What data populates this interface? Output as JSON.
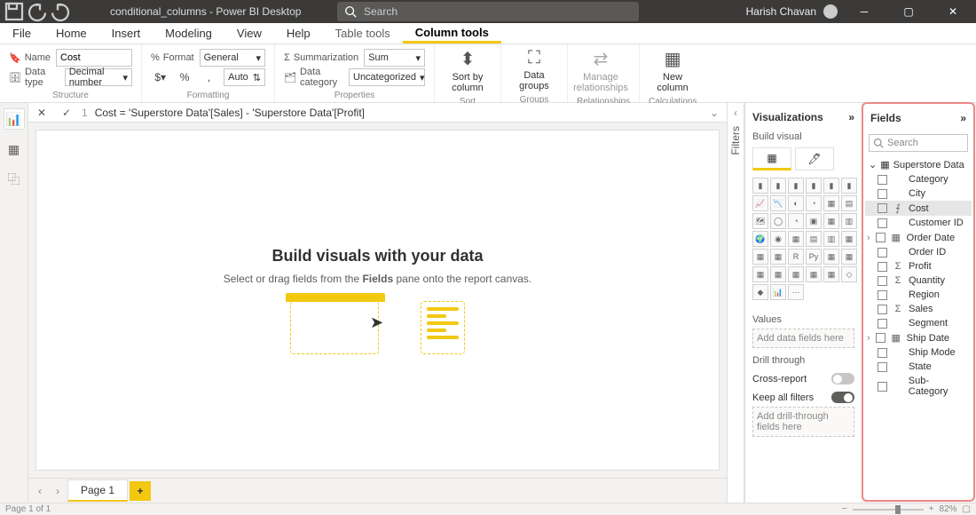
{
  "title": "conditional_columns - Power BI Desktop",
  "search_placeholder": "Search",
  "user_name": "Harish Chavan",
  "tabs": [
    "File",
    "Home",
    "Insert",
    "Modeling",
    "View",
    "Help",
    "Table tools",
    "Column tools"
  ],
  "active_tab": "Column tools",
  "ribbon": {
    "structure": {
      "name_label": "Name",
      "name_value": "Cost",
      "datatype_label": "Data type",
      "datatype_value": "Decimal number",
      "group": "Structure"
    },
    "formatting": {
      "format_label": "Format",
      "format_value": "General",
      "decimals": "Auto",
      "group": "Formatting"
    },
    "properties": {
      "summarization_label": "Summarization",
      "summarization_value": "Sum",
      "category_label": "Data category",
      "category_value": "Uncategorized",
      "group": "Properties"
    },
    "sort": {
      "label": "Sort by\ncolumn",
      "group": "Sort"
    },
    "groups": {
      "label": "Data\ngroups",
      "group": "Groups"
    },
    "relationships": {
      "label": "Manage\nrelationships",
      "group": "Relationships"
    },
    "calculations": {
      "label": "New\ncolumn",
      "group": "Calculations"
    }
  },
  "formula": {
    "line": "1",
    "text": "Cost = 'Superstore Data'[Sales] - 'Superstore Data'[Profit]"
  },
  "canvas": {
    "heading": "Build visuals with your data",
    "sub1": "Select or drag fields from the ",
    "sub_bold": "Fields",
    "sub2": " pane onto the report canvas."
  },
  "page_tab": "Page 1",
  "filters_label": "Filters",
  "viz": {
    "title": "Visualizations",
    "subtitle": "Build visual",
    "values_label": "Values",
    "values_placeholder": "Add data fields here",
    "drill_label": "Drill through",
    "cross_report": "Cross-report",
    "cross_report_state": "Off",
    "keep_filters": "Keep all filters",
    "keep_filters_state": "On",
    "drill_placeholder": "Add drill-through fields here"
  },
  "fields": {
    "title": "Fields",
    "search": "Search",
    "table": "Superstore Data",
    "items": [
      {
        "name": "Category",
        "icon": ""
      },
      {
        "name": "City",
        "icon": ""
      },
      {
        "name": "Cost",
        "icon": "fx",
        "selected": true
      },
      {
        "name": "Customer ID",
        "icon": ""
      },
      {
        "name": "Order Date",
        "icon": "cal",
        "hier": true
      },
      {
        "name": "Order ID",
        "icon": ""
      },
      {
        "name": "Profit",
        "icon": "Σ"
      },
      {
        "name": "Quantity",
        "icon": "Σ"
      },
      {
        "name": "Region",
        "icon": ""
      },
      {
        "name": "Sales",
        "icon": "Σ"
      },
      {
        "name": "Segment",
        "icon": ""
      },
      {
        "name": "Ship Date",
        "icon": "cal",
        "hier": true
      },
      {
        "name": "Ship Mode",
        "icon": ""
      },
      {
        "name": "State",
        "icon": ""
      },
      {
        "name": "Sub-Category",
        "icon": ""
      }
    ]
  },
  "status": {
    "page": "Page 1 of 1",
    "zoom": "82%"
  }
}
